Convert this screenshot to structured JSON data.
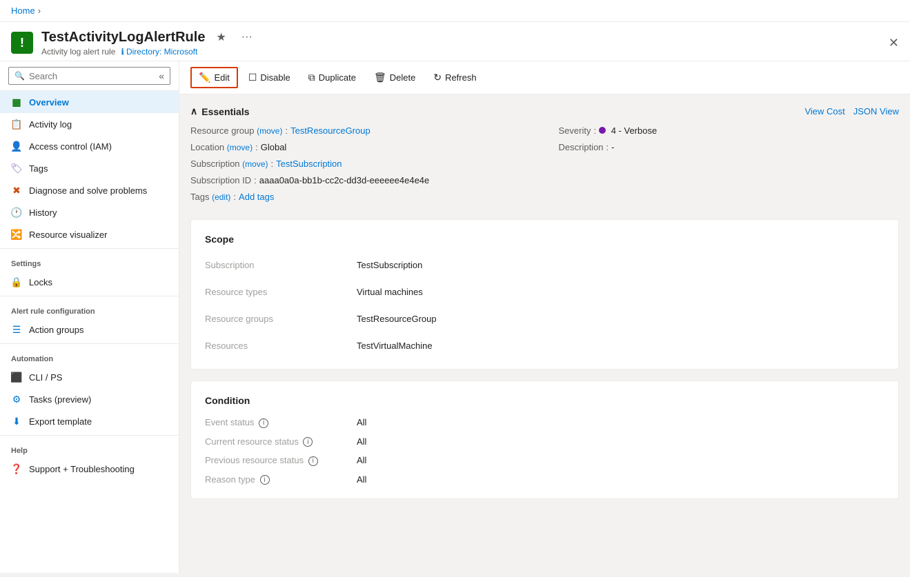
{
  "breadcrumb": {
    "home": "Home",
    "separator": "›"
  },
  "header": {
    "icon_bg": "#107c10",
    "icon_text": "!",
    "title": "TestActivityLogAlertRule",
    "subtitle_type": "Activity log alert rule",
    "subtitle_info_icon": "ℹ",
    "subtitle_directory": "Directory: Microsoft"
  },
  "toolbar": {
    "edit_label": "Edit",
    "disable_label": "Disable",
    "duplicate_label": "Duplicate",
    "delete_label": "Delete",
    "refresh_label": "Refresh"
  },
  "sidebar": {
    "search_placeholder": "Search",
    "items": [
      {
        "id": "overview",
        "label": "Overview",
        "icon": "▦",
        "active": true
      },
      {
        "id": "activity-log",
        "label": "Activity log",
        "icon": "📋",
        "active": false
      },
      {
        "id": "access-control",
        "label": "Access control (IAM)",
        "icon": "👤",
        "active": false
      },
      {
        "id": "tags",
        "label": "Tags",
        "icon": "🏷",
        "active": false
      },
      {
        "id": "diagnose",
        "label": "Diagnose and solve problems",
        "icon": "✖",
        "active": false
      },
      {
        "id": "history",
        "label": "History",
        "icon": "🕐",
        "active": false
      },
      {
        "id": "resource-visualizer",
        "label": "Resource visualizer",
        "icon": "🔀",
        "active": false
      }
    ],
    "sections": [
      {
        "title": "Settings",
        "items": [
          {
            "id": "locks",
            "label": "Locks",
            "icon": "🔒",
            "active": false
          }
        ]
      },
      {
        "title": "Alert rule configuration",
        "items": [
          {
            "id": "action-groups",
            "label": "Action groups",
            "icon": "☰",
            "active": false
          }
        ]
      },
      {
        "title": "Automation",
        "items": [
          {
            "id": "cli-ps",
            "label": "CLI / PS",
            "icon": "⬛",
            "active": false
          },
          {
            "id": "tasks-preview",
            "label": "Tasks (preview)",
            "icon": "⚙",
            "active": false
          },
          {
            "id": "export-template",
            "label": "Export template",
            "icon": "⬇",
            "active": false
          }
        ]
      },
      {
        "title": "Help",
        "items": [
          {
            "id": "support",
            "label": "Support + Troubleshooting",
            "icon": "❓",
            "active": false
          }
        ]
      }
    ]
  },
  "essentials": {
    "collapse_label": "Essentials",
    "view_cost_label": "View Cost",
    "json_view_label": "JSON View",
    "fields_left": [
      {
        "label": "Resource group",
        "move": true,
        "value": "TestResourceGroup",
        "link": true
      },
      {
        "label": "Location",
        "move": true,
        "value": "Global",
        "link": false
      },
      {
        "label": "Subscription",
        "move": true,
        "value": "TestSubscription",
        "link": true
      },
      {
        "label": "Subscription ID",
        "move": false,
        "value": "aaaa0a0a-bb1b-cc2c-dd3d-eeeeee4e4e4e",
        "link": false
      },
      {
        "label": "Tags",
        "edit": true,
        "value": "Add tags",
        "link": true
      }
    ],
    "fields_right": [
      {
        "label": "Severity",
        "value": "4 - Verbose",
        "dot": true
      },
      {
        "label": "Description",
        "value": "-"
      }
    ]
  },
  "scope": {
    "title": "Scope",
    "rows": [
      {
        "label": "Subscription",
        "value": "TestSubscription"
      },
      {
        "label": "Resource types",
        "value": "Virtual machines"
      },
      {
        "label": "Resource groups",
        "value": "TestResourceGroup"
      },
      {
        "label": "Resources",
        "value": "TestVirtualMachine"
      }
    ]
  },
  "condition": {
    "title": "Condition",
    "rows": [
      {
        "label": "Event status",
        "info": true,
        "value": "All"
      },
      {
        "label": "Current resource status",
        "info": true,
        "value": "All"
      },
      {
        "label": "Previous resource status",
        "info": true,
        "value": "All"
      },
      {
        "label": "Reason type",
        "info": true,
        "value": "All"
      }
    ]
  }
}
